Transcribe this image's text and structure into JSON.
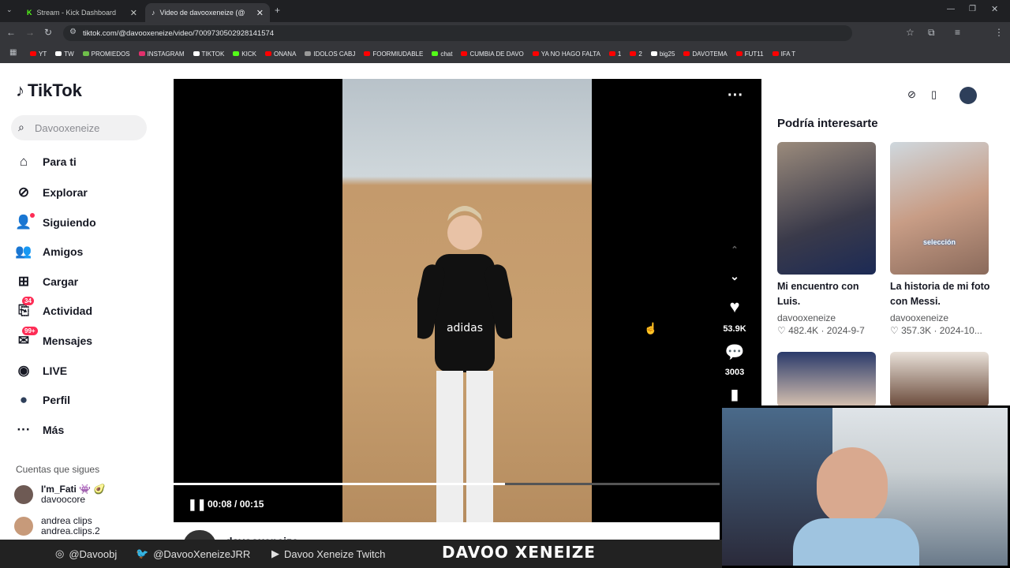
{
  "browser": {
    "tabs": [
      {
        "title": "Stream - Kick Dashboard"
      },
      {
        "title": "Video de davooxeneize (@"
      }
    ],
    "url": "tiktok.com/@davooxeneize/video/7009730502928141574",
    "bookmarks": [
      "YT",
      "TW",
      "PROMIEDOS",
      "INSTAGRAM",
      "TIKTOK",
      "KICK",
      "ONANA",
      "IDOLOS CABJ",
      "FOORMIUDABLE",
      "chat",
      "CUMBIA DE DAVO",
      "YA NO HAGO FALTA",
      "1",
      "2",
      "big25",
      "DAVOTEMA",
      "FUT11",
      "IFA T"
    ]
  },
  "tiktok": {
    "logo": "TikTok",
    "search_placeholder": "Davooxeneize",
    "nav": [
      {
        "label": "Para ti",
        "icon": "home-icon"
      },
      {
        "label": "Explorar",
        "icon": "compass-icon"
      },
      {
        "label": "Siguiendo",
        "icon": "following-icon"
      },
      {
        "label": "Amigos",
        "icon": "friends-icon"
      },
      {
        "label": "Cargar",
        "icon": "upload-icon"
      },
      {
        "label": "Actividad",
        "icon": "inbox-icon",
        "badge": "34"
      },
      {
        "label": "Mensajes",
        "icon": "messages-icon",
        "badge": "99+"
      },
      {
        "label": "LIVE",
        "icon": "live-icon"
      },
      {
        "label": "Perfil",
        "icon": "avatar"
      },
      {
        "label": "Más",
        "icon": "more-icon"
      }
    ],
    "following_title": "Cuentas que sigues",
    "following": [
      {
        "name": "I'm_Fati 👾 🥑",
        "handle": "davoocore"
      },
      {
        "name": "andrea clips",
        "handle": "andrea.clips.2"
      }
    ],
    "video": {
      "time": "00:08 / 00:15",
      "progress": 0.6,
      "likes": "53.9K",
      "comments": "3003",
      "author_partial": "davooxeneize"
    },
    "recommend_title": "Podría interesarte",
    "recommend": [
      {
        "title": "Mi encuentro con Luis.",
        "user": "davooxeneize",
        "stats": "482.4K · 2024-9-7"
      },
      {
        "title": "La historia de mi foto con Messi.",
        "user": "davooxeneize",
        "stats": "357.3K · 2024-10...",
        "overlay": "selección"
      }
    ]
  },
  "stream": {
    "instagram": "@Davoobj",
    "twitter": "@DavooXeneizeJRR",
    "youtube": "Davoo Xeneize Twitch",
    "brand": "DAVOO XENEIZE"
  }
}
